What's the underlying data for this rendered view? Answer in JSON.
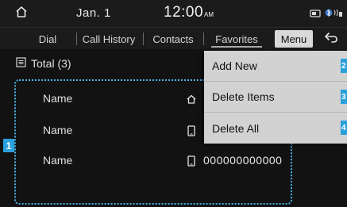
{
  "status_bar": {
    "home_icon": "home-icon",
    "date": "Jan.  1",
    "time": "12:00",
    "time_suffix": "AM",
    "icons": [
      "media-icon",
      "bluetooth-phone-icon"
    ]
  },
  "tabs": [
    {
      "label": "Dial"
    },
    {
      "label": "Call History"
    },
    {
      "label": "Contacts"
    },
    {
      "label": "Favorites",
      "selected": true
    }
  ],
  "menu_button": {
    "label": "Menu"
  },
  "back_button": {
    "icon": "back-arrow-icon"
  },
  "total": {
    "icon": "list-icon",
    "label": "Total (3)"
  },
  "favorites": [
    {
      "name": "Name",
      "icon": "home-icon",
      "number": ""
    },
    {
      "name": "Name",
      "icon": "mobile-icon",
      "number": ""
    },
    {
      "name": "Name",
      "icon": "mobile-icon",
      "number": "000000000000"
    }
  ],
  "dropdown_menu": {
    "items": [
      {
        "label": "Add New",
        "badge": "2"
      },
      {
        "label": "Delete Items",
        "badge": "3"
      },
      {
        "label": "Delete All",
        "badge": "4"
      }
    ]
  },
  "callout": {
    "label": "1"
  },
  "colors": {
    "background": "#121212",
    "bar": "#1b1b1b",
    "menu_bg": "#d2d2d2",
    "accent": "#2aa0dc"
  }
}
